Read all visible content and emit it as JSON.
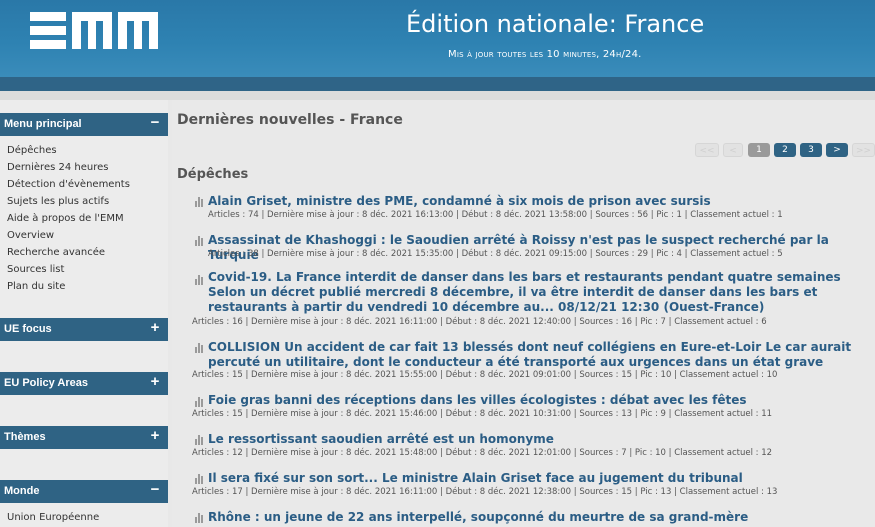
{
  "header": {
    "logo_text": "EMM",
    "title": "Édition nationale: France",
    "subtitle": "Mis à jour toutes les 10 minutes, 24h/24."
  },
  "sidebar": {
    "menu_principal": {
      "title": "Menu principal",
      "toggle": "−",
      "items": [
        "Dépêches",
        "Dernières 24 heures",
        "Détection d'évènements",
        "Sujets les plus actifs",
        "Aide à propos de l'EMM",
        "Overview",
        "Recherche avancée",
        "Sources list",
        "Plan du site"
      ]
    },
    "ue_focus": {
      "title": "UE focus",
      "toggle": "+"
    },
    "eu_policy": {
      "title": "EU Policy Areas",
      "toggle": "+"
    },
    "themes": {
      "title": "Thèmes",
      "toggle": "+"
    },
    "monde": {
      "title": "Monde",
      "toggle": "−",
      "items": [
        "Union Européenne"
      ]
    }
  },
  "main": {
    "heading": "Dernières nouvelles - France",
    "pagination": {
      "first": "<<",
      "prev": "<",
      "pages": [
        "1",
        "2",
        "3"
      ],
      "next": ">",
      "last": ">>"
    },
    "section": "Dépêches",
    "news": [
      {
        "title": "Alain Griset, ministre des PME, condamné à six mois de prison avec sursis",
        "meta": "Articles : 74 | Dernière mise à jour : 8 déc. 2021 16:13:00 | Début : 8 déc. 2021 13:58:00 | Sources : 56 | Pic : 1 | Classement actuel : 1"
      },
      {
        "title": "Assassinat de Khashoggi : le Saoudien arrêté à Roissy n'est pas le suspect recherché par la Turquie",
        "meta": "Articles : 38 | Dernière mise à jour : 8 déc. 2021 15:35:00 | Début : 8 déc. 2021 09:15:00 | Sources : 29 | Pic : 4 | Classement actuel : 5"
      },
      {
        "title": "Covid-19. La France interdit de danser dans les bars et restaurants pendant quatre semaines Selon un décret publié mercredi 8 décembre, il va être interdit de danser dans les bars et restaurants à partir du vendredi 10 décembre au... 08/12/21 12:30 (Ouest-France)",
        "meta": "Articles : 16 | Dernière mise à jour : 8 déc. 2021 16:11:00 | Début : 8 déc. 2021 12:40:00 | Sources : 16 | Pic : 7 | Classement actuel : 6"
      },
      {
        "title": "COLLISION Un accident de car fait 13 blessés dont neuf collégiens en Eure-et-Loir Le car aurait percuté un utilitaire, dont le conducteur a été transporté aux urgences dans un état grave",
        "meta": "Articles : 15 | Dernière mise à jour : 8 déc. 2021 15:55:00 | Début : 8 déc. 2021 09:01:00 | Sources : 15 | Pic : 10 | Classement actuel : 10"
      },
      {
        "title": "Foie gras banni des réceptions dans les villes écologistes : débat avec les fêtes",
        "meta": "Articles : 15 | Dernière mise à jour : 8 déc. 2021 15:46:00 | Début : 8 déc. 2021 10:31:00 | Sources : 13 | Pic : 9 | Classement actuel : 11"
      },
      {
        "title": "Le ressortissant saoudien arrêté est un homonyme",
        "meta": "Articles : 12 | Dernière mise à jour : 8 déc. 2021 15:48:00 | Début : 8 déc. 2021 12:01:00 | Sources : 7 | Pic : 10 | Classement actuel : 12"
      },
      {
        "title": "Il sera fixé sur son sort... Le ministre Alain Griset face au jugement du tribunal",
        "meta": "Articles : 17 | Dernière mise à jour : 8 déc. 2021 16:11:00 | Début : 8 déc. 2021 12:38:00 | Sources : 15 | Pic : 13 | Classement actuel : 13"
      },
      {
        "title": "Rhône : un jeune de 22 ans interpellé, soupçonné du meurtre de sa grand-mère",
        "meta": ""
      }
    ]
  }
}
